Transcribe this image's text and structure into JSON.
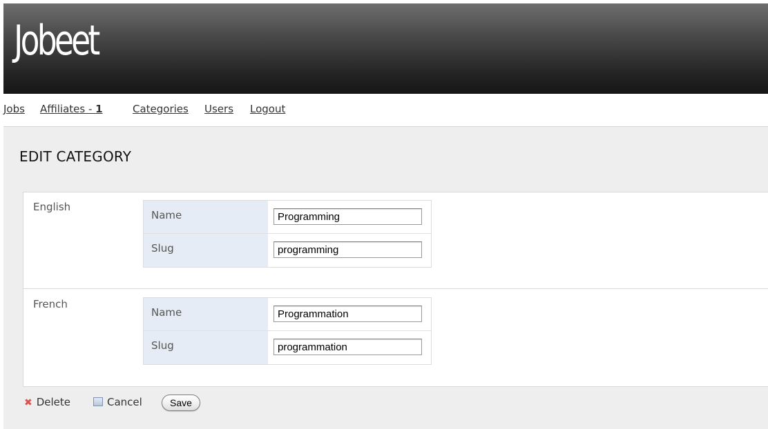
{
  "header": {
    "logo": "Jobeet"
  },
  "nav": {
    "items": [
      {
        "label": "Jobs"
      },
      {
        "label": "Affiliates - ",
        "count": "1"
      },
      {
        "label": "Categories"
      },
      {
        "label": "Users"
      },
      {
        "label": "Logout"
      }
    ]
  },
  "page_title": "EDIT CATEGORY",
  "translations": [
    {
      "language": "English",
      "name_label": "Name",
      "name_value": "Programming",
      "slug_label": "Slug",
      "slug_value": "programming"
    },
    {
      "language": "French",
      "name_label": "Name",
      "name_value": "Programmation",
      "slug_label": "Slug",
      "slug_value": "programmation"
    }
  ],
  "actions": {
    "delete_label": "Delete",
    "cancel_label": "Cancel",
    "save_label": "Save"
  },
  "colors": {
    "delete_icon": "#d9534f",
    "label_cell_bg": "#e6ecf5",
    "content_bg": "#eeeeee"
  },
  "icons": {
    "delete": "x-mark-icon",
    "cancel": "list-icon"
  }
}
